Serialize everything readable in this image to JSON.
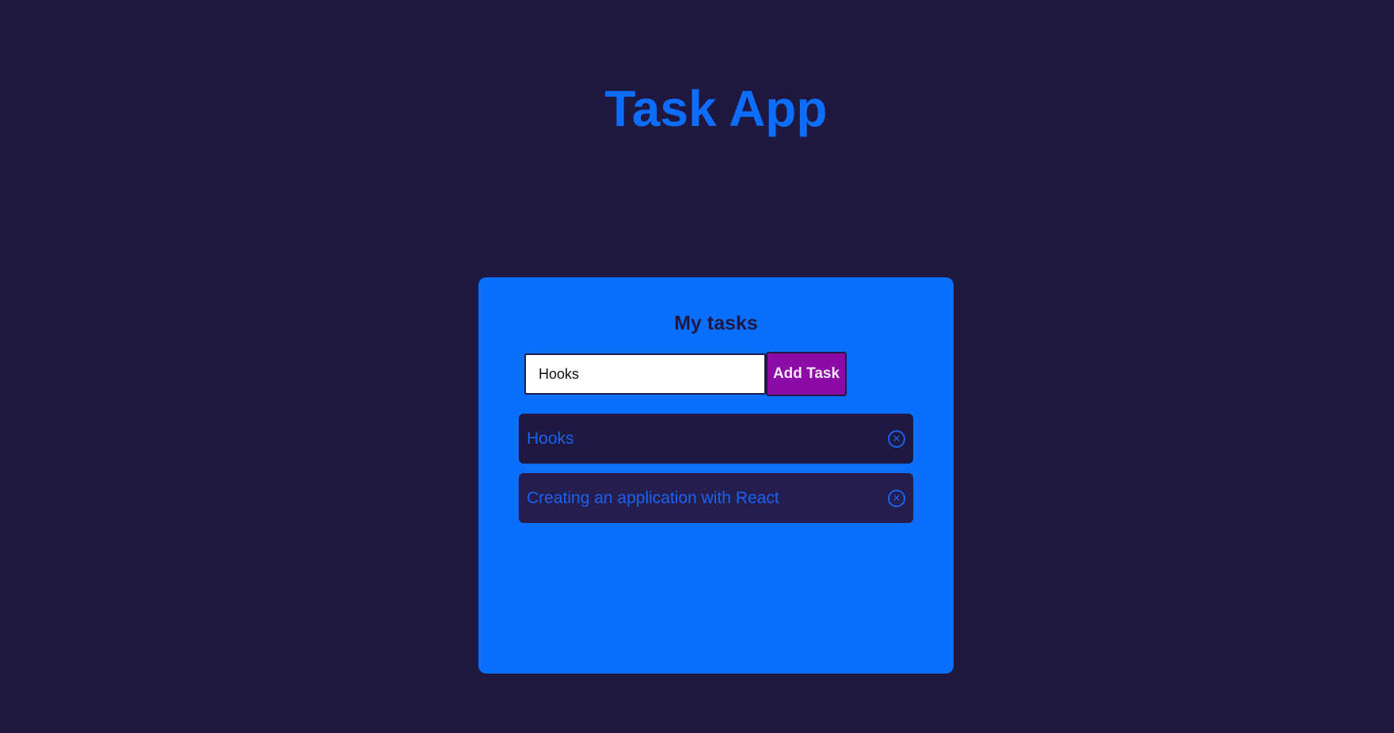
{
  "header": {
    "title": "Task App"
  },
  "card": {
    "title": "My tasks",
    "input_value": "Hooks",
    "add_button_label": "Add Task",
    "tasks": [
      {
        "text": "Hooks"
      },
      {
        "text": "Creating an application with React"
      }
    ]
  },
  "icons": {
    "remove": "circle-x-icon"
  },
  "colors": {
    "background": "#1e1840",
    "card": "#0b6ffd",
    "button": "#8c0ba6",
    "accent_text": "#1a63f0"
  }
}
